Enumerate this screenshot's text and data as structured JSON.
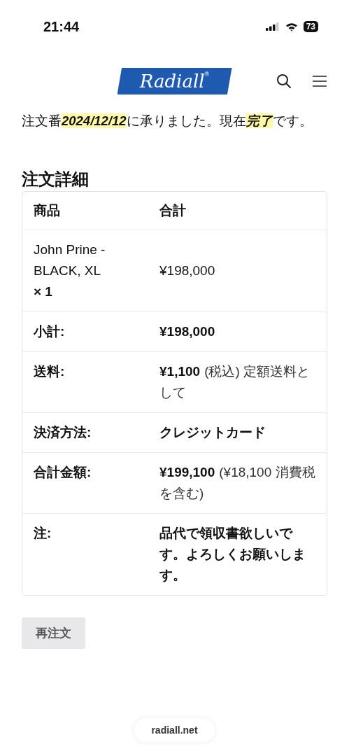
{
  "status_bar": {
    "time": "21:44",
    "battery": "73"
  },
  "header": {
    "logo": "Radiall",
    "logo_mark": "®"
  },
  "intro": {
    "segments": [
      {
        "text": "注文番",
        "highlight": false
      },
      {
        "text": "2024/12/12",
        "highlight": true
      },
      {
        "text": "に承りました。現在",
        "highlight": false
      },
      {
        "text": "完了",
        "highlight": true
      },
      {
        "text": "です。",
        "highlight": false
      }
    ]
  },
  "order_details": {
    "title": "注文詳細",
    "columns": [
      "商品",
      "合計"
    ],
    "items": [
      {
        "product": "John Prine - BLACK, XL",
        "quantity": "× 1",
        "total": "¥198,000"
      }
    ],
    "totals": [
      {
        "label": "小計:",
        "amount": "¥198,000"
      },
      {
        "label": "送料:",
        "amount": "¥1,100",
        "suffix": "(税込) 定額送料として"
      },
      {
        "label": "決済方法:",
        "amount": "クレジットカード"
      },
      {
        "label": "合計金額:",
        "amount": "¥199,100",
        "suffix": "(¥18,100 消費税を含む)"
      },
      {
        "label": "注:",
        "amount": "品代で領収書欲しいです。よろしくお願いします。"
      }
    ]
  },
  "reorder_button": "再注文",
  "url_bar": "radiall.net"
}
